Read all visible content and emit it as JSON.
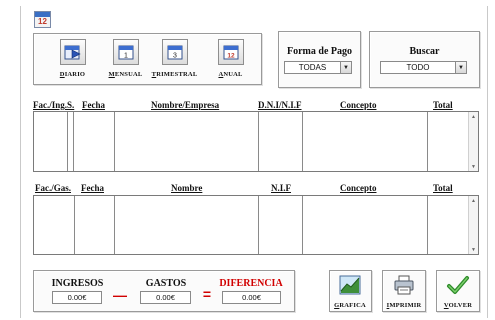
{
  "app": {
    "icon_text": "12"
  },
  "period_buttons": [
    {
      "label": "DIARIO",
      "icon": "calendar-day-icon"
    },
    {
      "label": "MENSUAL",
      "icon": "calendar-month-icon"
    },
    {
      "label": "TRIMESTRAL",
      "icon": "calendar-quarter-icon"
    },
    {
      "label": "ANUAL",
      "icon": "calendar-year-icon"
    }
  ],
  "filters": {
    "payment": {
      "title": "Forma de Pago",
      "value": "TODAS"
    },
    "search": {
      "title": "Buscar",
      "value": "TODO"
    }
  },
  "income_table": {
    "columns": [
      "Fac./Ing.S.",
      "Fecha",
      "Nombre/Empresa",
      "D.N.I/N.I.F",
      "Concepto",
      "Total"
    ]
  },
  "expense_table": {
    "columns": [
      "Fac./Gas.",
      "Fecha",
      "Nombre",
      "N.I.F",
      "Concepto",
      "Total"
    ]
  },
  "totals": {
    "income": {
      "label": "INGRESOS",
      "value": "0.00€"
    },
    "expenses": {
      "label": "GASTOS",
      "value": "0.00€"
    },
    "difference": {
      "label": "DIFERENCIA",
      "value": "0.00€",
      "color": "#d10000"
    },
    "minus": "—",
    "equals": "="
  },
  "actions": [
    {
      "label": "GRAFICA",
      "icon": "chart-icon"
    },
    {
      "label": "IMPRIMIR",
      "icon": "printer-icon"
    },
    {
      "label": "VOLVER",
      "icon": "back-arrow-icon"
    }
  ]
}
